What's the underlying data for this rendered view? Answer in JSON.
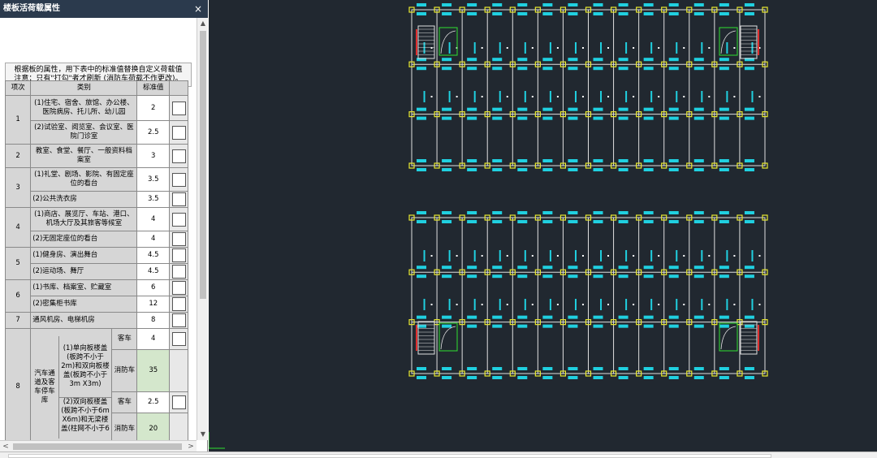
{
  "panel": {
    "title": "楼板活荷载属性",
    "close_glyph": "×",
    "note_line1": "根据板的属性，用下表中的标准值替换自定义荷载值",
    "note_line2": "注意：只有\"打勾\"者才刷新 (消防车荷载不作更改)。"
  },
  "table": {
    "headers": {
      "index": "项次",
      "category": "类别",
      "standard": "标准值"
    },
    "rows": [
      {
        "num": "1",
        "cat": "(1)住宅、宿舍、旅馆、办公楼、医院病房、托儿所、幼儿园",
        "val": "2"
      },
      {
        "cat": "(2)试验室、阅览室、会议室、医院门诊室",
        "val": "2.5"
      },
      {
        "num": "2",
        "cat": "教室、食堂、餐厅、一般资料档案室",
        "val": "3"
      },
      {
        "num": "3",
        "cat": "(1)礼堂、剧场、影院、有固定座位的看台",
        "val": "3.5"
      },
      {
        "cat": "(2)公共洗衣房",
        "val": "3.5"
      },
      {
        "num": "4",
        "cat": "(1)商店、展览厅、车站、港口、机场大厅及其旅客等候室",
        "val": "4"
      },
      {
        "cat": "(2)无固定座位的看台",
        "val": "4"
      },
      {
        "num": "5",
        "cat": "(1)健身房、演出舞台",
        "val": "4.5"
      },
      {
        "cat": "(2)运动场、舞厅",
        "val": "4.5"
      },
      {
        "num": "6",
        "cat": "(1)书库、档案室、贮藏室",
        "val": "6"
      },
      {
        "cat": "(2)密集柜书库",
        "val": "12"
      },
      {
        "num": "7",
        "cat": "通风机房、电梯机房",
        "val": "8"
      }
    ],
    "row8": {
      "num": "8",
      "group": "汽车通道及客车停车库",
      "sub1": "(1)单向板楼盖(板跨不小于2m)和双向板楼盖(板跨不小于3m X3m)",
      "sub2": "(2)双向板楼盖(板跨不小于6m X6m)和无梁楼盖(柱网不小于6",
      "car": "客车",
      "fire": "消防车",
      "v1": "4",
      "v2": "35",
      "v3": "2.5",
      "v4": "20"
    }
  },
  "scroll": {
    "up": "▲",
    "down": "▼",
    "left": "<",
    "right": ">"
  },
  "colors": {
    "canvas_bg": "#212830",
    "grid_line": "#e0e0e0",
    "label_cyan": "#20d0e0",
    "column_yellow": "#e8e830",
    "stair_red": "#e03030",
    "room_green": "#30e030"
  }
}
